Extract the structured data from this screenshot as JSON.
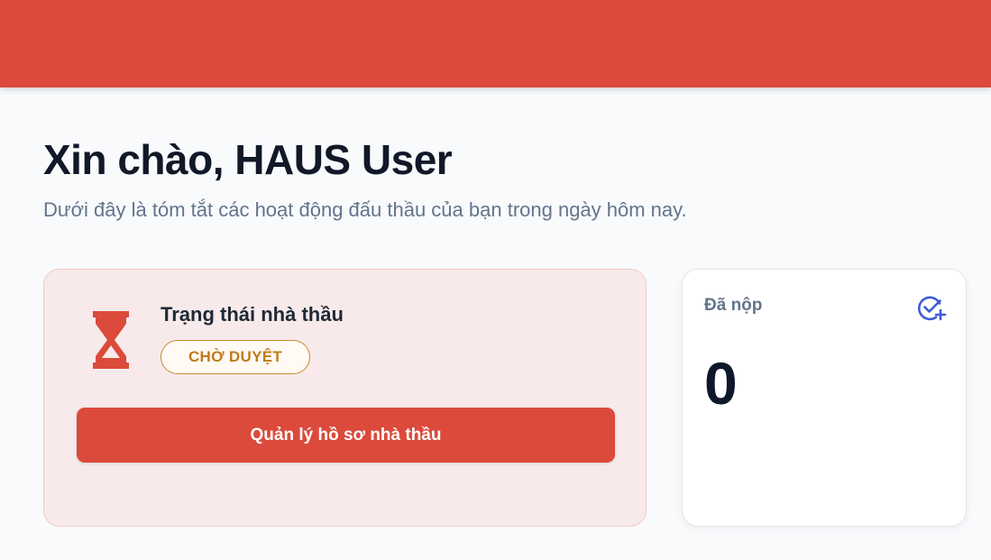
{
  "header": {
    "color": "#db4a3b"
  },
  "welcome": {
    "title": "Xin chào, HAUS User",
    "subtitle": "Dưới đây là tóm tắt các hoạt động đấu thầu của bạn trong ngày hôm nay."
  },
  "contractor_status": {
    "title": "Trạng thái nhà thầu",
    "status_badge": "CHỜ DUYỆT",
    "status_color": "#c17a1b",
    "icon": "hourglass-icon",
    "manage_button_label": "Quản lý hồ sơ nhà thầu"
  },
  "submitted": {
    "label": "Đã nộp",
    "value": "0",
    "icon": "check-circle-add-icon",
    "icon_color": "#3b5bdb"
  }
}
